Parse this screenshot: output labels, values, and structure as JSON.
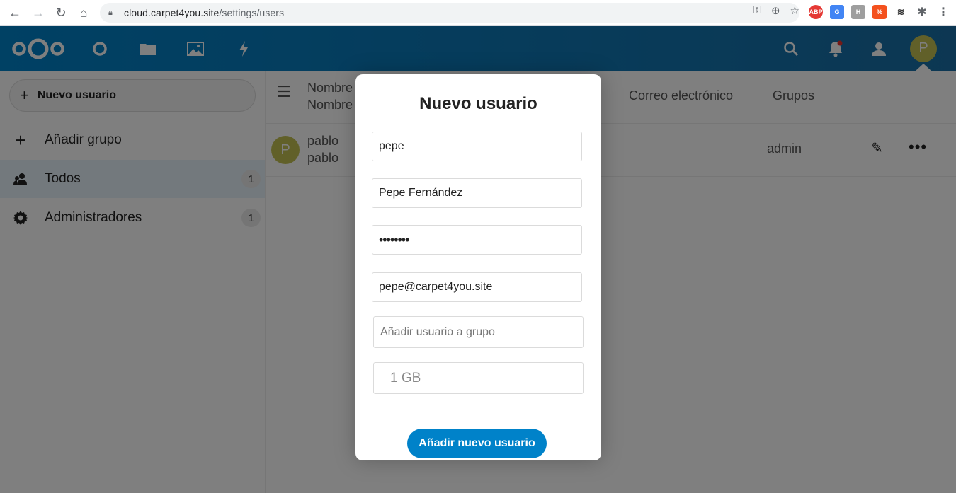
{
  "browser": {
    "url_domain": "cloud.carpet4you.site",
    "url_path": "/settings/users"
  },
  "sidebar": {
    "new_user_label": "Nuevo usuario",
    "items": [
      {
        "label": "Añadir grupo",
        "count": null
      },
      {
        "label": "Todos",
        "count": "1"
      },
      {
        "label": "Administradores",
        "count": "1"
      }
    ]
  },
  "header": {
    "avatar_initial": "P"
  },
  "grid": {
    "col_name_1": "Nombre",
    "col_name_2": "Nombre",
    "col_email": "Correo electrónico",
    "col_groups": "Grupos",
    "rows": [
      {
        "avatar": "P",
        "username": "pablo",
        "display_name": "pablo",
        "group": "admin"
      }
    ]
  },
  "modal": {
    "title": "Nuevo usuario",
    "username_value": "pepe",
    "displayname_value": "Pepe Fernández",
    "password_value": "••••••••",
    "email_value": "pepe@carpet4you.site",
    "group_placeholder": "Añadir usuario a grupo",
    "quota_value": "1 GB",
    "submit_label": "Añadir nuevo usuario"
  },
  "colors": {
    "primary": "#0082c9",
    "avatar": "#c3c152"
  }
}
